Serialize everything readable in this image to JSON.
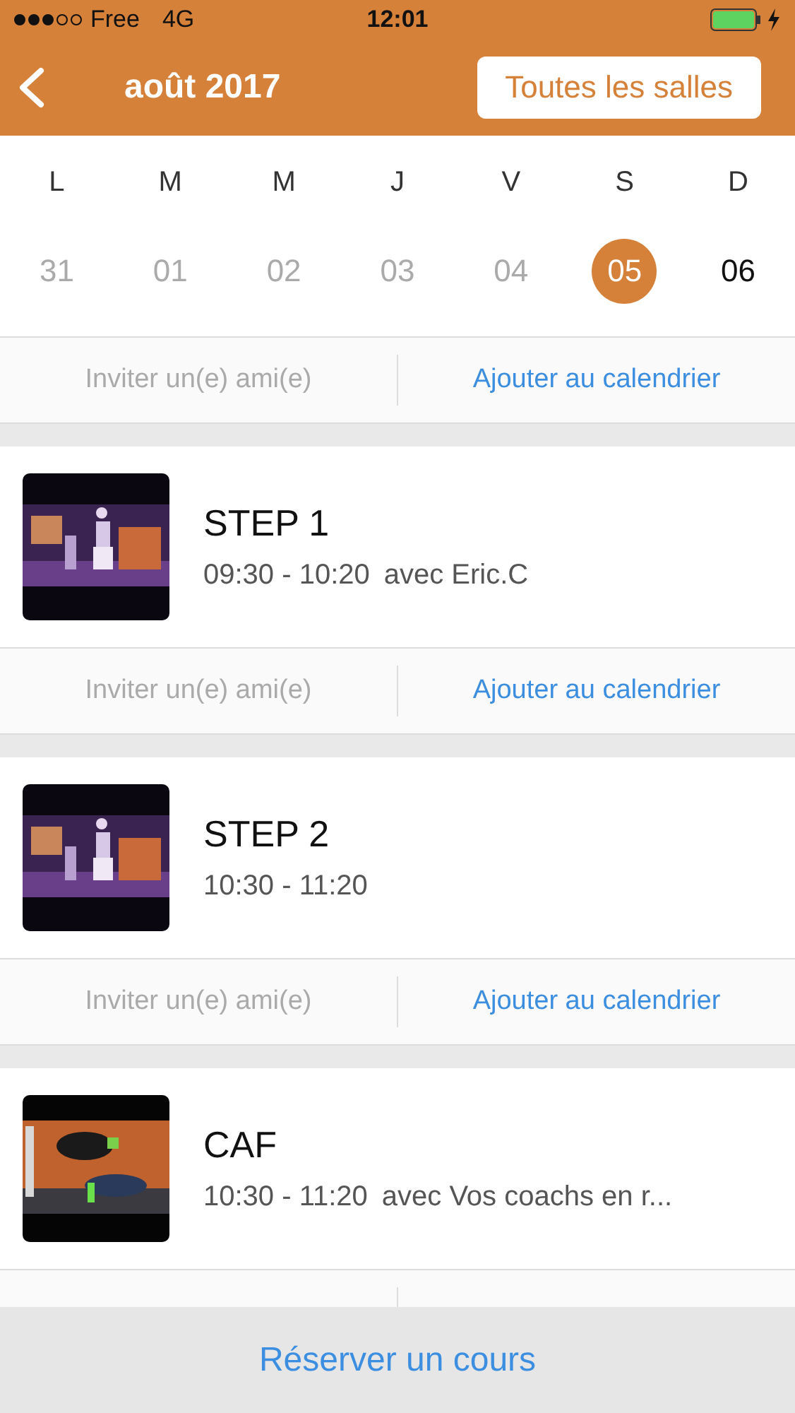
{
  "status_bar": {
    "carrier": "Free",
    "network": "4G",
    "time": "12:01"
  },
  "nav": {
    "title": "août 2017",
    "button": "Toutes les salles"
  },
  "week": [
    {
      "weekday": "L",
      "date": "31",
      "past": true,
      "selected": false
    },
    {
      "weekday": "M",
      "date": "01",
      "past": true,
      "selected": false
    },
    {
      "weekday": "M",
      "date": "02",
      "past": true,
      "selected": false
    },
    {
      "weekday": "J",
      "date": "03",
      "past": true,
      "selected": false
    },
    {
      "weekday": "V",
      "date": "04",
      "past": true,
      "selected": false
    },
    {
      "weekday": "S",
      "date": "05",
      "past": false,
      "selected": true
    },
    {
      "weekday": "D",
      "date": "06",
      "past": false,
      "selected": false
    }
  ],
  "top_actions": {
    "invite": "Inviter un(e) ami(e)",
    "calendar": "Ajouter au calendrier"
  },
  "classes": [
    {
      "title": "STEP 1",
      "time": "09:30 - 10:20",
      "coach": "avec Eric.C",
      "kind": "stage",
      "actions": {
        "invite": "Inviter un(e) ami(e)",
        "calendar": "Ajouter au calendrier"
      }
    },
    {
      "title": "STEP 2",
      "time": "10:30 - 11:20",
      "kind": "stage",
      "actions": {
        "invite": "Inviter un(e) ami(e)",
        "calendar": "Ajouter au calendrier"
      }
    },
    {
      "title": "CAF",
      "time": "10:30 - 11:20",
      "coach": "avec Vos coachs en r...",
      "kind": "gym"
    }
  ],
  "bottom_button": "Réserver un cours"
}
